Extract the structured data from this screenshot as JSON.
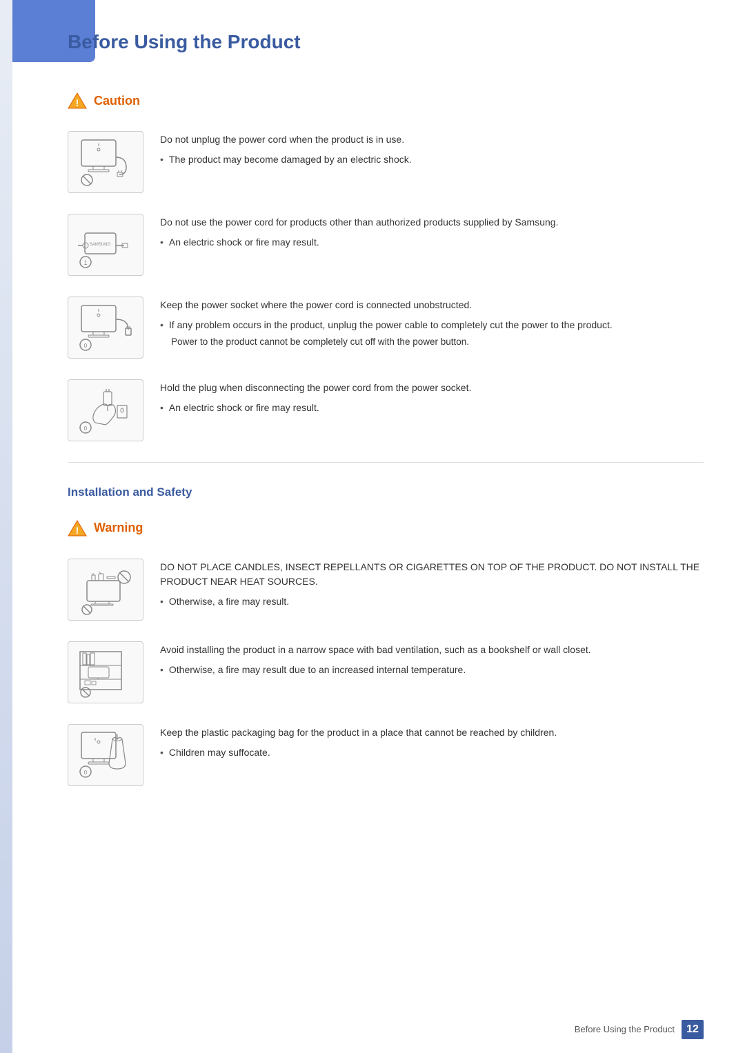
{
  "page": {
    "title": "Before Using the Product",
    "footer_label": "Before Using the Product",
    "page_number": "12"
  },
  "caution_section": {
    "label": "Caution",
    "items": [
      {
        "id": "caution-1",
        "main_text": "Do not unplug the power cord when the product is in use.",
        "bullet": "The product may become damaged by an electric shock.",
        "sub_text": null
      },
      {
        "id": "caution-2",
        "main_text": "Do not use the power cord for products other than authorized products supplied by Samsung.",
        "bullet": "An electric shock or fire may result.",
        "sub_text": null
      },
      {
        "id": "caution-3",
        "main_text": "Keep the power socket where the power cord is connected unobstructed.",
        "bullet": "If any problem occurs in the product, unplug the power cable to completely cut the power to the product.",
        "sub_text": "Power to the product cannot be completely cut off with the power button."
      },
      {
        "id": "caution-4",
        "main_text": "Hold the plug when disconnecting the power cord from the power socket.",
        "bullet": "An electric shock or fire may result.",
        "sub_text": null
      }
    ]
  },
  "install_heading": "Installation and Safety",
  "warning_section": {
    "label": "Warning",
    "items": [
      {
        "id": "warning-1",
        "main_text": "DO NOT PLACE CANDLES, INSECT REPELLANTS OR CIGARETTES ON TOP OF THE PRODUCT. DO NOT INSTALL THE PRODUCT NEAR HEAT SOURCES.",
        "bullet": "Otherwise, a fire may result.",
        "sub_text": null
      },
      {
        "id": "warning-2",
        "main_text": "Avoid installing the product in a narrow space with bad ventilation, such as a bookshelf or wall closet.",
        "bullet": "Otherwise, a fire may result due to an increased internal temperature.",
        "sub_text": null
      },
      {
        "id": "warning-3",
        "main_text": "Keep the plastic packaging bag for the product in a place that cannot be reached by children.",
        "bullet": "Children may suffocate.",
        "sub_text": null
      }
    ]
  }
}
